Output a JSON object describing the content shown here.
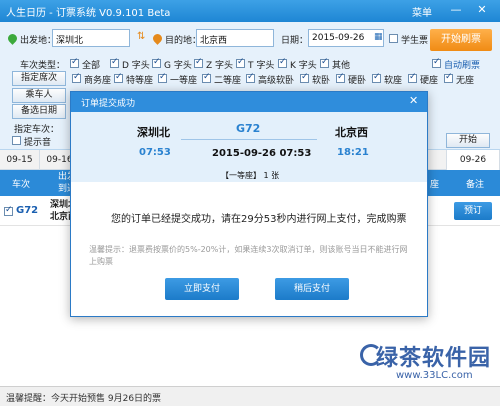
{
  "window": {
    "title": "人生日历 - 订票系统 V0.9.101 Beta",
    "menu_label": "菜单",
    "minimize": "—",
    "close": "✕"
  },
  "search": {
    "from_label": "出发地：",
    "from_value": "深圳北",
    "to_label": "目的地：",
    "to_value": "北京西",
    "date_label": "日期：",
    "date_value": "2015-09-26",
    "student_label": "学生票",
    "start_button": "开始刷票",
    "train_type_label": "车次类型：",
    "train_types": [
      "全部",
      "D 字头",
      "G 字头",
      "Z 字头",
      "T 字头",
      "K 字头",
      "其他"
    ],
    "auto_book_label": "自动刷票",
    "seat_button": "指定席次",
    "seat_types": [
      "商务座",
      "特等座",
      "一等座",
      "二等座",
      "高级软卧",
      "软卧",
      "硬卧",
      "软座",
      "硬座",
      "无座"
    ],
    "passenger_button": "乘车人",
    "backup_date_button": "备选日期",
    "specify_train_label": "指定车次：",
    "tip_sound_label": "提示音",
    "start_small_button": "开始"
  },
  "date_tabs": [
    "09-15",
    "09-16",
    "09-26"
  ],
  "table": {
    "headers": [
      "车次",
      "出发\n到达",
      "座",
      "备注"
    ],
    "rows": [
      {
        "train": "G72",
        "stations": "深圳北\n北京西",
        "action": "预订"
      }
    ]
  },
  "dialog": {
    "title": "订单提交成功",
    "close": "✕",
    "from": "深圳北",
    "from_time": "07:53",
    "to": "北京西",
    "to_time": "18:21",
    "train": "G72",
    "datetime": "2015-09-26 07:53",
    "seat": "【一等座】 1 张",
    "message": "您的订单已经提交成功，请在29分53秒内进行网上支付，完成购票",
    "tip": "温馨提示：退票费按票价的5%-20%计，如果连续3次取消订单，则该账号当日不能进行网上购票",
    "pay_button": "立即支付",
    "later_button": "稍后支付"
  },
  "status": {
    "text": "温馨提醒：今天开始预售 9月26日的票"
  },
  "watermark": {
    "brand": "绿茶软件园",
    "url": "www.33LC.com"
  }
}
